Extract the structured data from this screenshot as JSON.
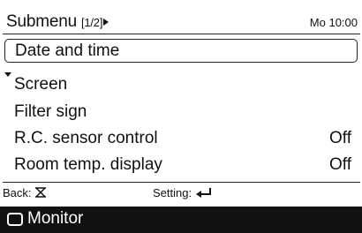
{
  "header": {
    "title": "Submenu",
    "page": "[1/2]",
    "clock": "Mo 10:00"
  },
  "menu": {
    "items": [
      {
        "label": "Date and time",
        "value": "",
        "selected": true
      },
      {
        "label": "Screen",
        "value": ""
      },
      {
        "label": "Filter sign",
        "value": ""
      },
      {
        "label": "R.C. sensor control",
        "value": "Off"
      },
      {
        "label": "Room temp. display",
        "value": "Off"
      }
    ]
  },
  "footer": {
    "back_label": "Back:",
    "setting_label": "Setting:"
  },
  "bottom_bar": {
    "label": "Monitor"
  }
}
